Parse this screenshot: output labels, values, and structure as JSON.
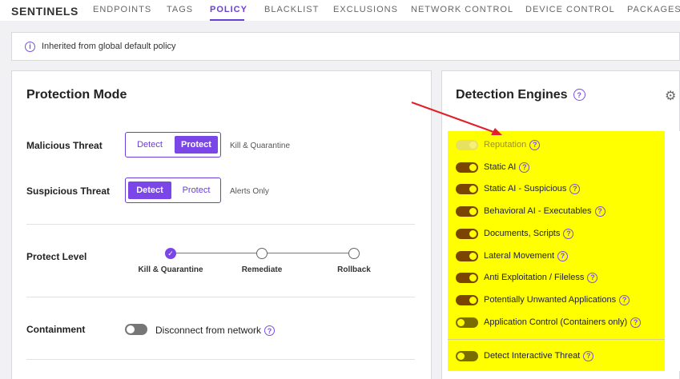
{
  "nav": {
    "brand": "SENTINELS",
    "tabs": [
      {
        "label": "ENDPOINTS"
      },
      {
        "label": "TAGS"
      },
      {
        "label": "POLICY",
        "active": true
      },
      {
        "label": "BLACKLIST"
      },
      {
        "label": "EXCLUSIONS"
      },
      {
        "label": "NETWORK CONTROL"
      },
      {
        "label": "DEVICE CONTROL"
      },
      {
        "label": "PACKAGES"
      }
    ]
  },
  "banner": {
    "icon": "info-icon",
    "text": "Inherited from global default policy"
  },
  "protection": {
    "title": "Protection Mode",
    "malicious": {
      "label": "Malicious Threat",
      "detect": "Detect",
      "protect": "Protect",
      "selected": "Protect",
      "note": "Kill & Quarantine"
    },
    "suspicious": {
      "label": "Suspicious Threat",
      "detect": "Detect",
      "protect": "Protect",
      "selected": "Detect",
      "note": "Alerts Only"
    },
    "level": {
      "label": "Protect Level",
      "stops": [
        "Kill & Quarantine",
        "Remediate",
        "Rollback"
      ],
      "selected": "Kill & Quarantine"
    },
    "containment": {
      "label": "Containment",
      "toggle_text": "Disconnect from network",
      "enabled": false
    }
  },
  "engines": {
    "title": "Detection Engines",
    "items": [
      {
        "label": "Reputation",
        "state": "disabled"
      },
      {
        "label": "Static AI",
        "state": "on"
      },
      {
        "label": "Static AI - Suspicious",
        "state": "on"
      },
      {
        "label": "Behavioral AI - Executables",
        "state": "on"
      },
      {
        "label": "Documents, Scripts",
        "state": "on"
      },
      {
        "label": "Lateral Movement",
        "state": "on"
      },
      {
        "label": "Anti Exploitation / Fileless",
        "state": "on"
      },
      {
        "label": "Potentially Unwanted Applications",
        "state": "on"
      },
      {
        "label": "Application Control (Containers only)",
        "state": "off"
      }
    ],
    "extra": {
      "label": "Detect Interactive Threat",
      "state": "off"
    },
    "highlight_color": "#ffff00"
  },
  "colors": {
    "accent": "#6a3fd8",
    "toggle_on": "#7a4500",
    "arrow": "#e0202a"
  }
}
